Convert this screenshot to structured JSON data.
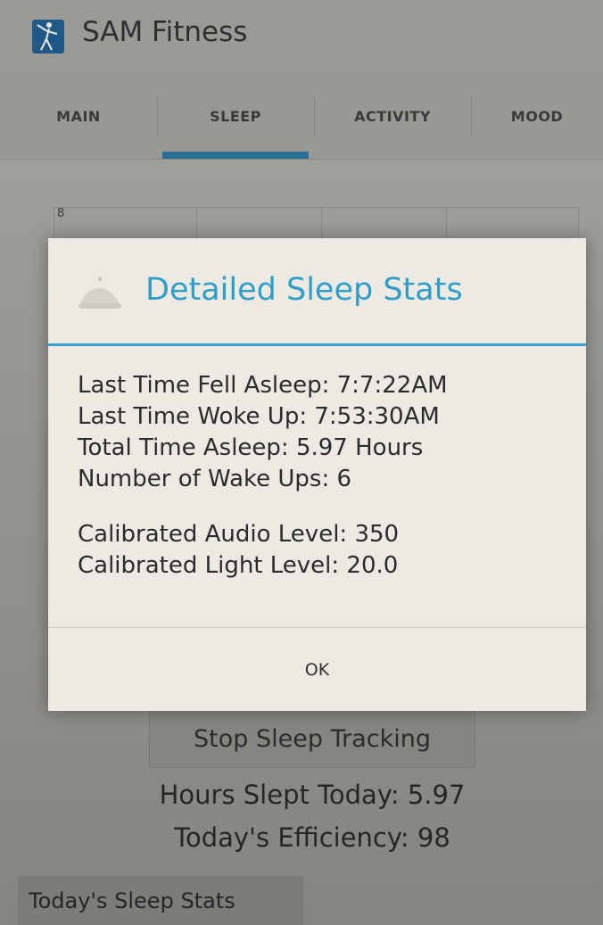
{
  "app": {
    "title": "SAM Fitness",
    "logo_icon": "stick-figure-icon"
  },
  "tabs": [
    {
      "label": "MAIN",
      "selected": false
    },
    {
      "label": "SLEEP",
      "selected": true
    },
    {
      "label": "ACTIVITY",
      "selected": false
    },
    {
      "label": "MOOD",
      "selected": false
    }
  ],
  "chart": {
    "y_label_top": "8"
  },
  "dialog": {
    "icon": "sleep-cap-icon",
    "title": "Detailed Sleep Stats",
    "stats": [
      "Last Time Fell Asleep: 7:7:22AM",
      "Last Time Woke Up: 7:53:30AM",
      "Total Time Asleep: 5.97 Hours",
      "Number of Wake Ups: 6"
    ],
    "calibration": [
      "Calibrated Audio Level: 350",
      "Calibrated Light Level: 20.0"
    ],
    "ok_label": "OK"
  },
  "main": {
    "stop_button_label": "Stop Sleep Tracking",
    "hours_slept": "Hours Slept Today: 5.97",
    "efficiency": "Today's Efficiency: 98",
    "stats_tab_label": "Today's Sleep Stats"
  },
  "colors": {
    "accent": "#2f9fc9",
    "tab_indicator": "#2a6f94",
    "logo_bg": "#1f5a86"
  }
}
